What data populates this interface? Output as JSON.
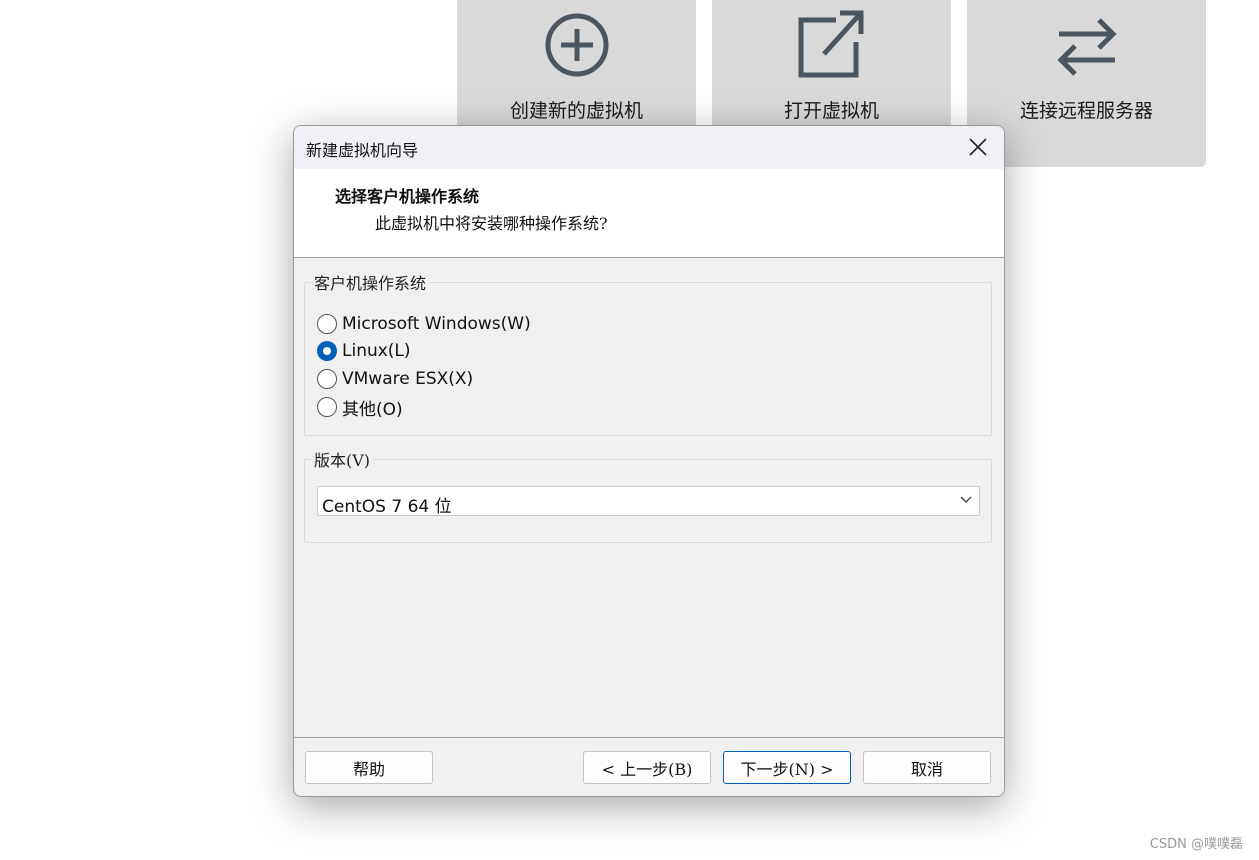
{
  "tiles": [
    {
      "label": "创建新的虚拟机",
      "icon": "plus-circle-icon"
    },
    {
      "label": "打开虚拟机",
      "icon": "external-open-icon"
    },
    {
      "label": "连接远程服务器",
      "icon": "swap-arrows-icon"
    }
  ],
  "dialog": {
    "title": "新建虚拟机向导",
    "header_title": "选择客户机操作系统",
    "header_subtitle": "此虚拟机中将安装哪种操作系统?",
    "os_group": {
      "title": "客户机操作系统",
      "options": [
        {
          "label": "Microsoft Windows(W)",
          "checked": false
        },
        {
          "label": "Linux(L)",
          "checked": true
        },
        {
          "label": "VMware ESX(X)",
          "checked": false
        },
        {
          "label": "其他(O)",
          "checked": false
        }
      ]
    },
    "version_group": {
      "title": "版本(V)",
      "selected": "CentOS 7 64 位"
    },
    "buttons": {
      "help": "帮助",
      "back": "< 上一步(B)",
      "next": "下一步(N) >",
      "cancel": "取消"
    }
  },
  "colors": {
    "accent": "#005fb8",
    "tile_bg": "#d9d9d9",
    "icon": "#4a5560"
  },
  "watermark": "CSDN @噗噗磊"
}
